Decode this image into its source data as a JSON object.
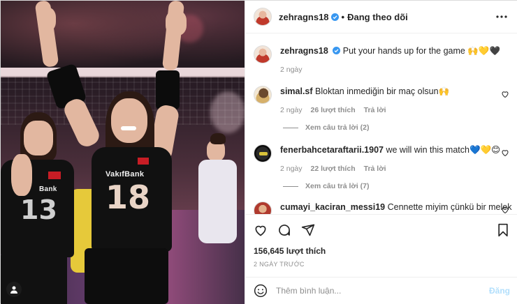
{
  "post": {
    "author": "zehragns18",
    "follow_status": "Đang theo dõi",
    "separator": "•",
    "caption": {
      "username": "zehragns18",
      "text": "Put your hands up for the game 🙌💛🖤",
      "time": "2 ngày"
    },
    "photo": {
      "jersey_number": "18",
      "sponsor": "VakıfBank",
      "left_jersey_number": "13",
      "left_sponsor": "Bank"
    },
    "comments": [
      {
        "username": "simal.sf",
        "text": "Bloktan inmediğin bir maç olsun🙌",
        "time": "2 ngày",
        "likes": "26 lượt thích",
        "reply_label": "Trả lời",
        "view_replies": "Xem câu trả lời (2)"
      },
      {
        "username": "fenerbahcetaraftarii.1907",
        "text": "we will win this match💙💛😊",
        "time": "2 ngày",
        "likes": "22 lượt thích",
        "reply_label": "Trả lời",
        "view_replies": "Xem câu trả lời (7)"
      },
      {
        "username": "cumayi_kaciran_messi19",
        "text": "Cennette miyim çünkü bir melek"
      }
    ],
    "likes_count": "156,645 lượt thích",
    "posted_ago": "2 NGÀY TRƯỚC",
    "comment_box": {
      "placeholder": "Thêm bình luận...",
      "post_label": "Đăng"
    },
    "colors": {
      "verified": "#3897f0",
      "post_button_disabled": "#b2dffc",
      "secondary_text": "#8e8e8e"
    },
    "icons": {
      "more": "more-options-icon",
      "like": "heart-icon",
      "comment": "comment-icon",
      "share": "share-icon",
      "save": "bookmark-icon",
      "emoji": "emoji-icon",
      "tagged_user": "user-tag-icon"
    }
  }
}
